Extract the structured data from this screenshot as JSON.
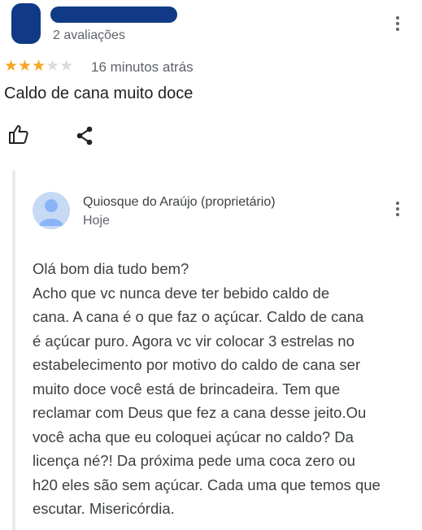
{
  "review": {
    "rating_count_label": "2 avaliações",
    "rating": 3,
    "rating_max": 5,
    "time_label": "16 minutos atrás",
    "text": "Caldo de cana muito doce"
  },
  "reply": {
    "owner_name": "Quiosque do Araújo (proprietário)",
    "date_label": "Hoje",
    "lines": [
      "Olá bom dia tudo bem?",
      "Acho que vc nunca deve ter bebido caldo de",
      "cana. A cana é o que faz o açúcar. Caldo de cana",
      "é açúcar puro. Agora vc vir colocar 3 estrelas no",
      "estabelecimento por motivo do caldo de cana ser",
      "muito doce você está de brincadeira. Tem que",
      "reclamar com Deus que fez a cana desse jeito.Ou",
      "você acha que eu coloquei açúcar no caldo? Da",
      "licença né?! Da próxima pede uma coca zero ou",
      "h20 eles são sem açúcar. Cada uma que temos que",
      "escutar. Misericórdia."
    ]
  },
  "icons": {
    "like": "thumbs-up-icon",
    "share": "share-icon",
    "menu": "more-vert-icon",
    "owner_avatar": "person-icon"
  },
  "colors": {
    "redaction": "#103a85",
    "star_filled": "#f5a623",
    "star_empty": "#dadce0",
    "secondary_text": "#5f6368"
  }
}
